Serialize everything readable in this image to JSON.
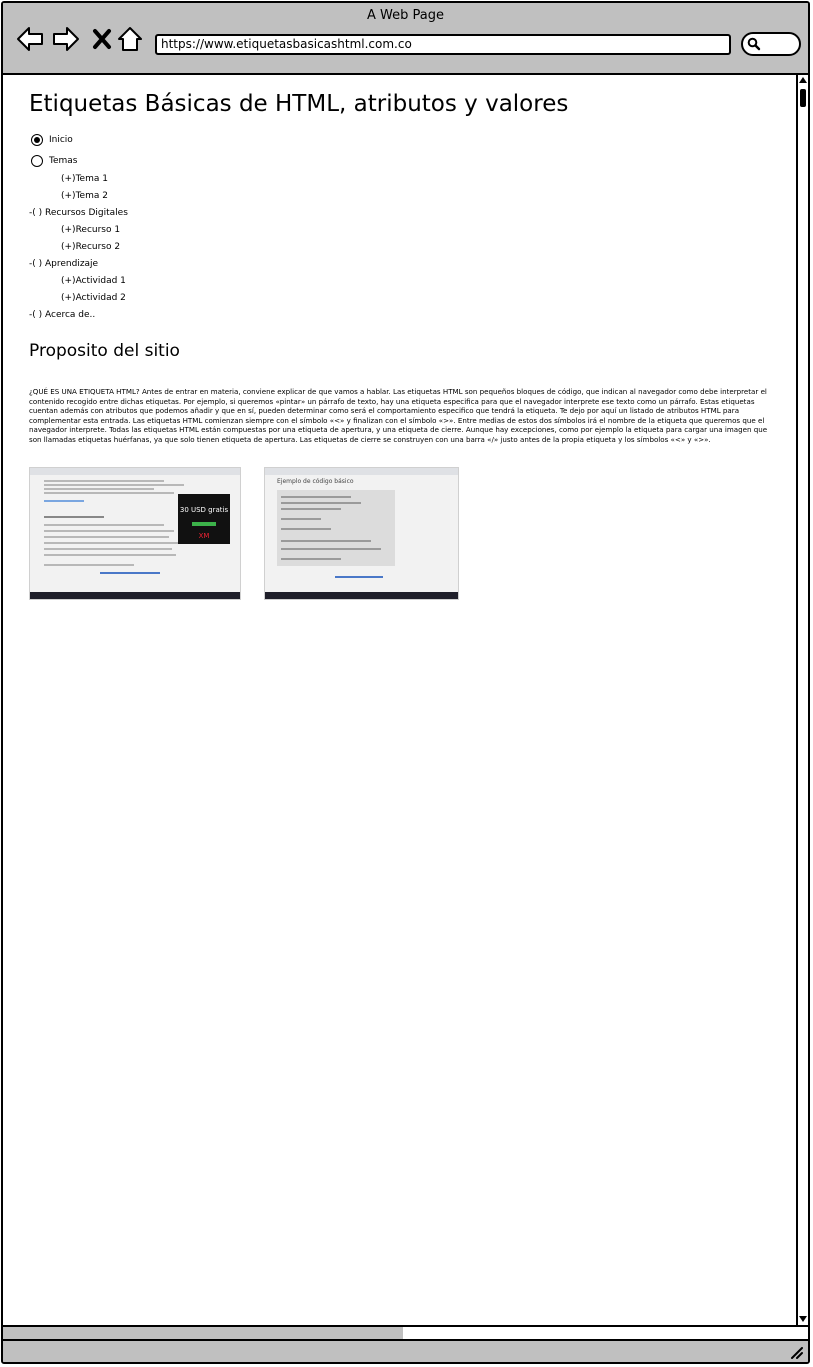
{
  "window": {
    "title": "A Web Page"
  },
  "toolbar": {
    "url": "https://www.etiquetasbasicashtml.com.co",
    "icons": [
      "back-arrow-icon",
      "forward-arrow-icon",
      "close-x-icon",
      "home-icon",
      "search-icon"
    ]
  },
  "page": {
    "title": "Etiquetas Básicas de HTML, atributos y valores",
    "menu": {
      "inicio": "Inicio",
      "temas": "Temas",
      "tema1": "(+)Tema 1",
      "tema2": "(+)Tema 2",
      "recursos": "-( ) Recursos Digitales",
      "recurso1": "(+)Recurso 1",
      "recurso2": "(+)Recurso 2",
      "aprendizaje": "-( ) Aprendizaje",
      "actividad1": "(+)Actividad 1",
      "actividad2": "(+)Actividad 2",
      "acerca": "-( ) Acerca de..",
      "selected": "Inicio"
    },
    "section_title": "Proposito del sitio",
    "paragraph": "¿QUÉ ES UNA ETIQUETA HTML? Antes de entrar en materia, conviene explicar de que vamos a hablar. Las etiquetas HTML son pequeños bloques de código, que indican al navegador como debe interpretar el contenido recogido entre dichas etiquetas. Por ejemplo, si queremos «pintar» un párrafo de texto, hay una etiqueta especifica para que el navegador interprete ese texto como un párrafo. Estas etiquetas cuentan además con atributos que podemos añadir y que en sí, pueden determinar como será el comportamiento especifico que tendrá la etiqueta. Te dejo por aquí un listado de atributos HTML para complementar esta entrada. Las etiquetas HTML comienzan siempre con el símbolo «<» y finalizan con el símbolo «>». Entre medias de estos dos símbolos irá el nombre de la etiqueta que queremos que el navegador interprete. Todas las etiquetas HTML están compuestas por una etiqueta de apertura, y una etiqueta de cierre. Aunque hay excepciones, como por ejemplo la etiqueta para cargar una imagen que son llamadas etiquetas huérfanas, ya que solo tienen etiqueta de apertura. Las etiquetas de cierre se construyen con una barra «/» justo antes de la propia etiqueta y los símbolos «<» y «>».",
    "screenshot1": {
      "ad_line1": "30 USD gratis",
      "ad_brand": "XM"
    },
    "screenshot2": {
      "heading": "Ejemplo de código básico"
    }
  },
  "colors": {
    "chrome": "#c0c0c0",
    "border": "#000000",
    "background": "#ffffff"
  }
}
